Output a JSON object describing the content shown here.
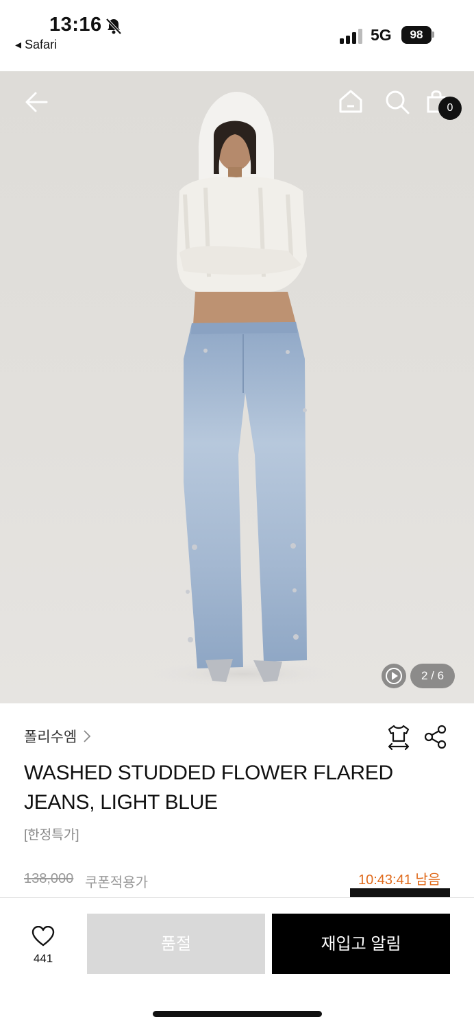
{
  "status_bar": {
    "time": "13:16",
    "back_app": "◂ Safari",
    "network": "5G",
    "battery": "98"
  },
  "hero": {
    "cart_count": "0",
    "page_counter": "2 / 6"
  },
  "product": {
    "brand": "폴리수엠",
    "title": "WASHED STUDDED FLOWER FLARED JEANS, LIGHT BLUE",
    "tag": "[한정특가]",
    "original_price": "138,000",
    "price_label": "쿠폰적용가",
    "countdown": "10:43:41 남음"
  },
  "bottom_bar": {
    "like_count": "441",
    "soldout_label": "품절",
    "restock_label": "재입고 알림"
  },
  "colors": {
    "accent_countdown": "#e06a1b",
    "soldout_bg": "#d9d9d9",
    "primary_button": "#000000"
  },
  "icons": [
    "bell-slash-icon",
    "signal-icon",
    "back-arrow-icon",
    "home-icon",
    "search-icon",
    "cart-icon",
    "play-icon",
    "chevron-right-icon",
    "size-guide-icon",
    "share-icon",
    "heart-icon"
  ]
}
